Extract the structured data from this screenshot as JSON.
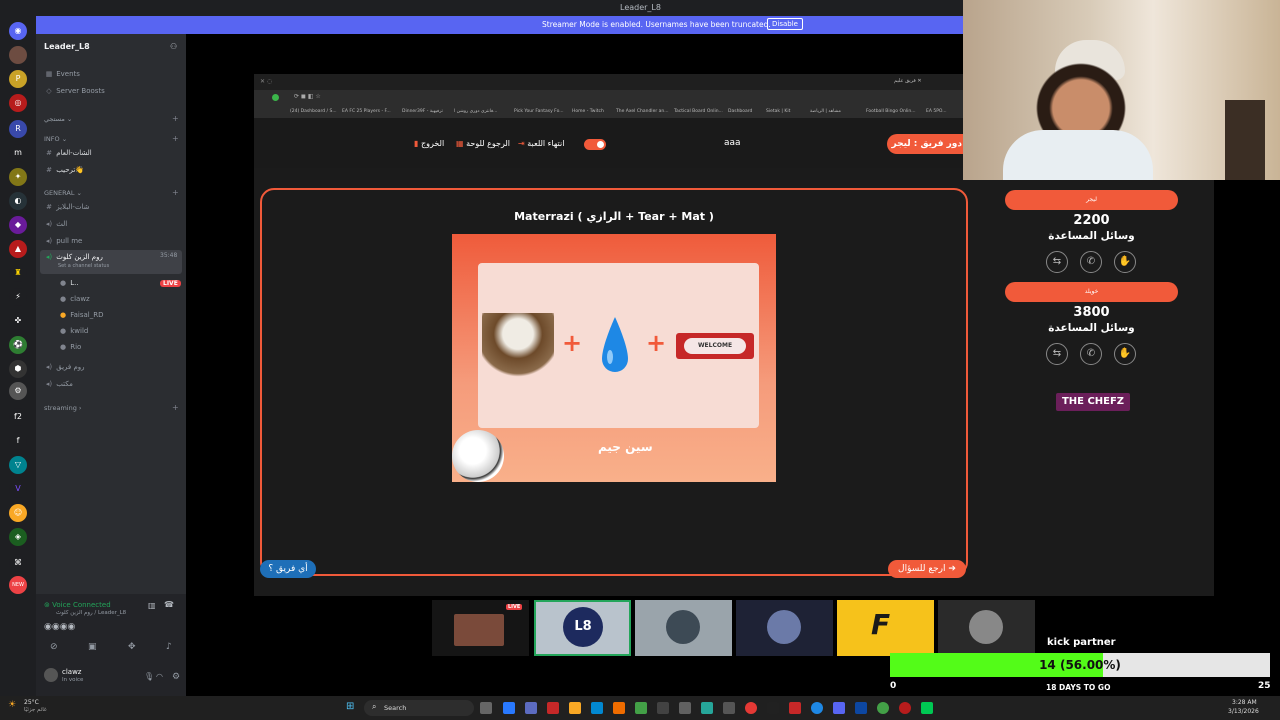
{
  "window": {
    "title": "Leader_L8"
  },
  "banner": {
    "message": "Streamer Mode is enabled. Usernames have been truncated.",
    "disable_label": "Disable"
  },
  "server": {
    "name": "Leader_L8",
    "menu": [
      {
        "label": "Events"
      },
      {
        "label": "Server Boosts"
      }
    ],
    "categories": [
      {
        "name": "INFO",
        "channels": [
          {
            "type": "text",
            "name": "الشات-العام"
          },
          {
            "type": "text",
            "name": "ترحيب👋"
          }
        ]
      },
      {
        "name": "GENERAL",
        "channels": [
          {
            "type": "text",
            "name": "شات-البلايز"
          },
          {
            "type": "voice",
            "name": "الث"
          },
          {
            "type": "voice",
            "name": "pull me"
          },
          {
            "type": "voice",
            "name": "روم الزين كلوث",
            "status": "Set a channel status",
            "timer": "35:48"
          }
        ]
      },
      {
        "name": "streaming",
        "channels": []
      }
    ],
    "voice_members": [
      {
        "name": "L..",
        "live": "LIVE"
      },
      {
        "name": "clawz"
      },
      {
        "name": "Faisal_RD"
      },
      {
        "name": "kwild"
      },
      {
        "name": "Rio"
      }
    ],
    "extra_voice": [
      {
        "name": "روم فريق"
      },
      {
        "name": "مكتب"
      }
    ]
  },
  "user_panel": {
    "voice_status": "Voice Connected",
    "voice_channel": "روم الزين كلوث / Leader_L8",
    "username": "clawz",
    "user_status": "In voice"
  },
  "rail_badges": [
    "28",
    "2",
    "13",
    "1",
    "4",
    "6",
    "139",
    "1"
  ],
  "rail_labels": [
    "m",
    "f2",
    "f",
    "NEW"
  ],
  "browser": {
    "bookmarks": [
      "(24) Dashboard / S...",
      "EA FC 25 Players - F...",
      "Dinner39F - ترفيهية",
      "فانتزي دوري روشن ا...",
      "Pick Your Fantasy Fo...",
      "Home - Twitch",
      "The Axel Chandler an...",
      "Tactical Board Onlin...",
      "Dashboard",
      "Sietak | Kit",
      "مشاهد | الرياضة",
      "Football Bingo Onlin...",
      "EA 5PO..."
    ],
    "tab_label": "فريق عليم"
  },
  "game": {
    "header": {
      "exit": "الخروج",
      "board": "الرجوع للوحة",
      "end_game": "انتهاء اللعبة",
      "center": "aaa",
      "turn": "دور فريق : ليجر"
    },
    "question_title": "Materrazi ( الرازي + Tear + Mat )",
    "welcome_text": "WELCOME",
    "brand_mark": "سين جيم",
    "back_to_question": "ارجع للسؤال",
    "any_team": "أي فريق ؟",
    "teams": [
      {
        "name": "ليجر",
        "score": "2200",
        "aids_label": "وسائل المساعدة"
      },
      {
        "name": "خويلد",
        "score": "3800",
        "aids_label": "وسائل المساعدة"
      }
    ],
    "sponsor": "THE CHEFZ"
  },
  "tiles": [
    {
      "live": "LIVE"
    }
  ],
  "kick": {
    "label": "kick partner",
    "progress_text": "14 (56.00%)",
    "progress": 0.56,
    "min": "0",
    "max": "25",
    "days_left": "18 DAYS TO GO"
  },
  "taskbar": {
    "weather_temp": "25°C",
    "weather_desc": "غائم جزئيًا",
    "search_placeholder": "Search",
    "time": "3:28 AM",
    "date": "3/13/2026"
  },
  "colors": {
    "accent": "#f15a3a",
    "discord_blurple": "#5865f2",
    "kick_green": "#53fc18",
    "live_red": "#ed4245"
  }
}
